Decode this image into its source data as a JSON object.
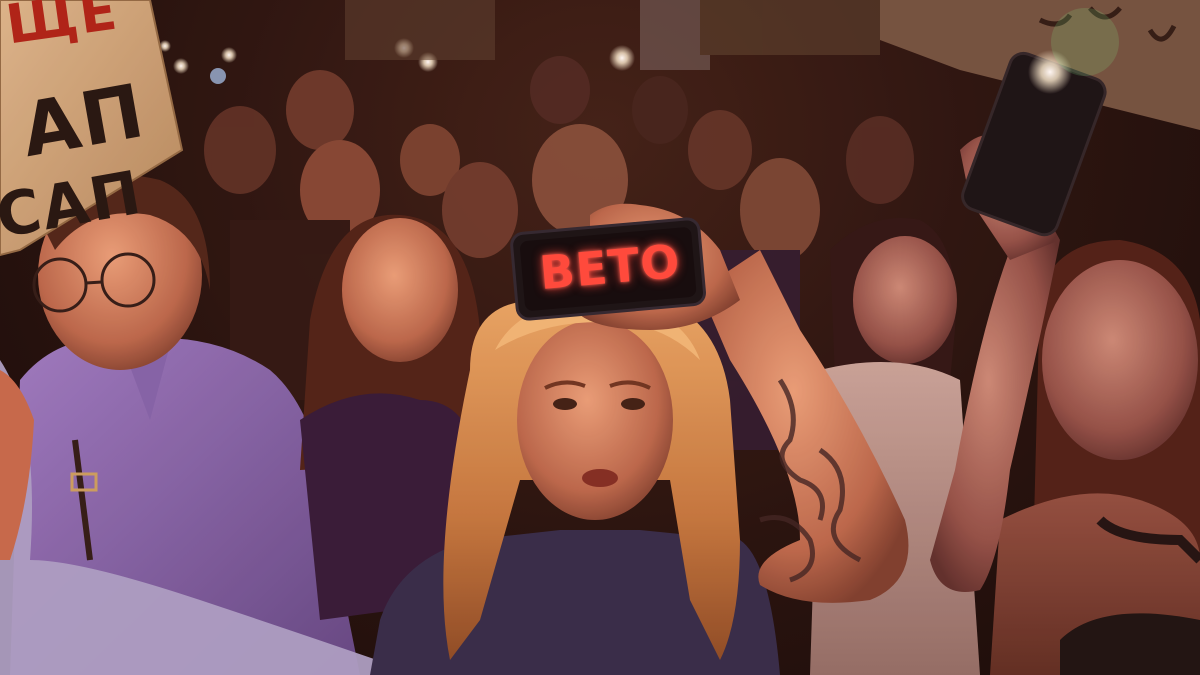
{
  "photo": {
    "sign_left": {
      "line1": "ЩЕ",
      "line2": "АП",
      "line3": "САП"
    },
    "phone_screen_text": "ВЕТО"
  },
  "colors": {
    "phone_text": "#ff4a3c",
    "ambient_warm": "#e07a50",
    "ambient_violet": "#7b5aa8",
    "cardboard": "#c9a67a"
  }
}
